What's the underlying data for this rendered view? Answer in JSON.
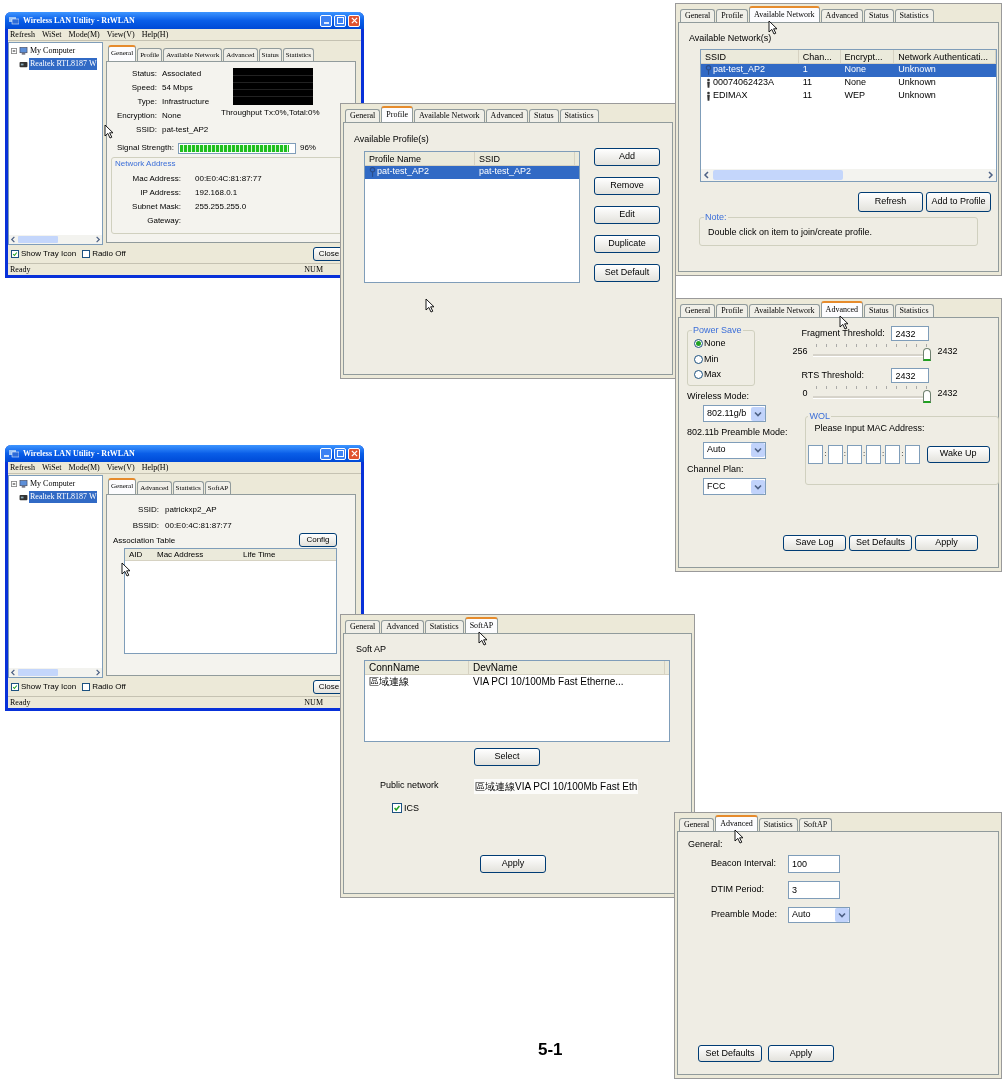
{
  "general_window": {
    "title": "Wireless LAN Utility - RtWLAN",
    "menu": [
      "Refresh",
      "WiSet",
      "Mode(M)",
      "View(V)",
      "Help(H)"
    ],
    "tree": {
      "label": "My Computer",
      "expanded": true,
      "children": [
        {
          "label": "Realtek RTL8187 W",
          "selected": true
        }
      ]
    },
    "tabs": [
      {
        "label": "General",
        "selected": true
      },
      {
        "label": "Profile",
        "selected": false
      },
      {
        "label": "Available Network",
        "selected": false
      },
      {
        "label": "Advanced",
        "selected": false
      },
      {
        "label": "Status",
        "selected": false
      },
      {
        "label": "Statistics",
        "selected": false
      }
    ],
    "fields": [
      {
        "label": "Status:",
        "value": "Associated"
      },
      {
        "label": "Speed:",
        "value": "54 Mbps"
      },
      {
        "label": "Type:",
        "value": "Infrastructure"
      },
      {
        "label": "Encryption:",
        "value": "None"
      },
      {
        "label": "SSID:",
        "value": "pat-test_AP2"
      }
    ],
    "throughput": "Throughput Tx:0%,Total:0%",
    "signal": {
      "label": "Signal Strength:",
      "level": 0.96,
      "reading": "96%"
    },
    "address_group": {
      "title": "Network Address",
      "fields": [
        {
          "label": "Mac Address:",
          "value": "00:E0:4C:81:87:77"
        },
        {
          "label": "IP Address:",
          "value": "192.168.0.1"
        },
        {
          "label": "Subnet Mask:",
          "value": "255.255.255.0"
        },
        {
          "label": "Gateway:"
        }
      ]
    },
    "options": [
      {
        "label": "Show Tray Icon",
        "checked": true
      },
      {
        "label": "Radio Off",
        "checked": false
      }
    ],
    "close_button": "Close",
    "status_bar": [
      "Ready",
      "NUM"
    ]
  },
  "profile_panel": {
    "tabs": [
      {
        "label": "General",
        "selected": false
      },
      {
        "label": "Profile",
        "selected": true
      },
      {
        "label": "Available Network",
        "selected": false
      },
      {
        "label": "Advanced",
        "selected": false
      },
      {
        "label": "Status",
        "selected": false
      },
      {
        "label": "Statistics",
        "selected": false
      }
    ],
    "heading": "Available Profile(s)",
    "columns": [
      "Profile Name",
      "SSID"
    ],
    "rows": [
      {
        "selected": true,
        "cells": [
          "pat-test_AP2",
          "pat-test_AP2"
        ]
      }
    ],
    "buttons": [
      "Add",
      "Remove",
      "Edit",
      "Duplicate",
      "Set Default"
    ]
  },
  "network_panel": {
    "tabs": [
      {
        "label": "General",
        "selected": false
      },
      {
        "label": "Profile",
        "selected": false
      },
      {
        "label": "Available Network",
        "selected": true
      },
      {
        "label": "Advanced",
        "selected": false
      },
      {
        "label": "Status",
        "selected": false
      },
      {
        "label": "Statistics",
        "selected": false
      }
    ],
    "heading": "Available Network(s)",
    "columns": [
      "SSID",
      "Chan...",
      "Encrypt...",
      "Network Authenticati..."
    ],
    "rows": [
      {
        "kind": "connected",
        "selected": true,
        "cells": [
          "pat-test_AP2",
          "1",
          "None",
          "Unknown"
        ]
      },
      {
        "kind": "available",
        "selected": false,
        "cells": [
          "00074062423A",
          "11",
          "None",
          "Unknown"
        ]
      },
      {
        "kind": "available",
        "selected": false,
        "cells": [
          "EDIMAX",
          "11",
          "WEP",
          "Unknown"
        ]
      }
    ],
    "buttons": [
      "Refresh",
      "Add to Profile"
    ],
    "note_title": "Note:",
    "note": "Double click on item to join/create profile."
  },
  "advanced_panel": {
    "tabs": [
      {
        "label": "General",
        "selected": false
      },
      {
        "label": "Profile",
        "selected": false
      },
      {
        "label": "Available Network",
        "selected": false
      },
      {
        "label": "Advanced",
        "selected": true
      },
      {
        "label": "Status",
        "selected": false
      },
      {
        "label": "Statistics",
        "selected": false
      }
    ],
    "power_save": {
      "title": "Power Save",
      "options": [
        {
          "label": "None",
          "selected": true
        },
        {
          "label": "Min",
          "selected": false
        },
        {
          "label": "Max",
          "selected": false
        }
      ]
    },
    "fragment": {
      "label": "Fragment Threshold:",
      "value": "2432",
      "min": "256",
      "max": "2432",
      "level": 1
    },
    "rts": {
      "label": "RTS Threshold:",
      "value": "2432",
      "min": "0",
      "max": "2432",
      "level": 1
    },
    "selects": [
      {
        "label": "Wireless Mode:",
        "value": "802.11g/b"
      },
      {
        "label": "802.11b Preamble Mode:",
        "value": "Auto"
      },
      {
        "label": "Channel Plan:",
        "value": "FCC"
      }
    ],
    "wol": {
      "title": "WOL",
      "prompt": "Please Input MAC Address:",
      "separators": [
        ":",
        ":",
        ":",
        ":",
        ":"
      ],
      "button": "Wake Up"
    },
    "buttons": [
      "Save Log",
      "Set Defaults",
      "Apply"
    ]
  },
  "softap_window": {
    "title": "Wireless LAN Utility - RtWLAN",
    "menu": [
      "Refresh",
      "WiSet",
      "Mode(M)",
      "View(V)",
      "Help(H)"
    ],
    "tree": {
      "label": "My Computer",
      "expanded": true,
      "children": [
        {
          "label": "Realtek RTL8187 W",
          "selected": true
        }
      ]
    },
    "tabs": [
      {
        "label": "General",
        "selected": true
      },
      {
        "label": "Advanced",
        "selected": false
      },
      {
        "label": "Statistics",
        "selected": false
      },
      {
        "label": "SoftAP",
        "selected": false
      }
    ],
    "fields": [
      {
        "label": "SSID:",
        "value": "patrickxp2_AP"
      },
      {
        "label": "BSSID:",
        "value": "00:E0:4C:81:87:77"
      }
    ],
    "config_button": "Config",
    "table_title": "Association Table",
    "columns": [
      "AID",
      "Mac Address",
      "Life Time"
    ],
    "options": [
      {
        "label": "Show Tray Icon",
        "checked": true
      },
      {
        "label": "Radio Off",
        "checked": false
      }
    ],
    "close_button": "Close",
    "status_bar": [
      "Ready",
      "NUM"
    ]
  },
  "softap_panel": {
    "tabs": [
      {
        "label": "General",
        "selected": false
      },
      {
        "label": "Advanced",
        "selected": false
      },
      {
        "label": "Statistics",
        "selected": false
      },
      {
        "label": "SoftAP",
        "selected": true
      }
    ],
    "heading": "Soft AP",
    "columns": [
      "ConnName",
      "DevName"
    ],
    "rows": [
      {
        "selected": false,
        "cells": [
          "區域連線",
          "VIA PCI 10/100Mb Fast Etherne..."
        ]
      }
    ],
    "select_button": "Select",
    "public_label": "Public network",
    "public_value": "區域連線VIA PCI 10/100Mb Fast Eth",
    "ics": {
      "label": "ICS",
      "checked": true
    },
    "apply_button": "Apply"
  },
  "softap_advanced_panel": {
    "tabs": [
      {
        "label": "General",
        "selected": false
      },
      {
        "label": "Advanced",
        "selected": true
      },
      {
        "label": "Statistics",
        "selected": false
      },
      {
        "label": "SoftAP",
        "selected": false
      }
    ],
    "heading": "General:",
    "fields": [
      {
        "kind": "text",
        "label": "Beacon Interval:",
        "value": "100"
      },
      {
        "kind": "text",
        "label": "DTIM Period:",
        "value": "3"
      },
      {
        "kind": "select",
        "label": "Preamble Mode:",
        "value": "Auto"
      }
    ],
    "buttons": [
      "Set Defaults",
      "Apply"
    ]
  },
  "page_number": "5-1"
}
